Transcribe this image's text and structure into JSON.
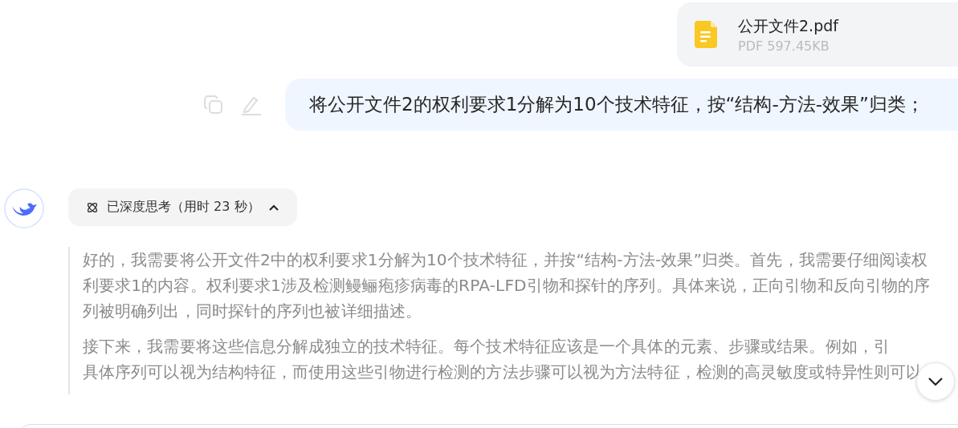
{
  "attachment": {
    "name": "公开文件2.pdf",
    "meta": "PDF 597.45KB"
  },
  "user_message": {
    "text": "将公开文件2的权利要求1分解为10个技术特征，按“结构-方法-效果”归类；"
  },
  "thinking_toggle": {
    "label": "已深度思考（用时 23 秒）",
    "expanded": true
  },
  "thinking_paragraphs": [
    {
      "lines": [
        "好的，我需要将公开文件2中的权利要求1分解为10个技术特征，并按“结构-方法-效果”归类。首先，我需要仔细阅读权",
        "利要求1的内容。权利要求1涉及检测鳗鲡疱疹病毒的RPA-LFD引物和探针的序列。具体来说，正向引物和反向引物的序",
        "列被明确列出，同时探针的序列也被详细描述。"
      ]
    },
    {
      "lines": [
        "接下来，我需要将这些信息分解成独立的技术特征。每个技术特征应该是一个具体的元素、步骤或结果。例如，引",
        "具体序列可以视为结构特征，而使用这些引物进行检测的方法步骤可以视为方法特征，检测的高灵敏度或特异性则可以"
      ]
    }
  ]
}
